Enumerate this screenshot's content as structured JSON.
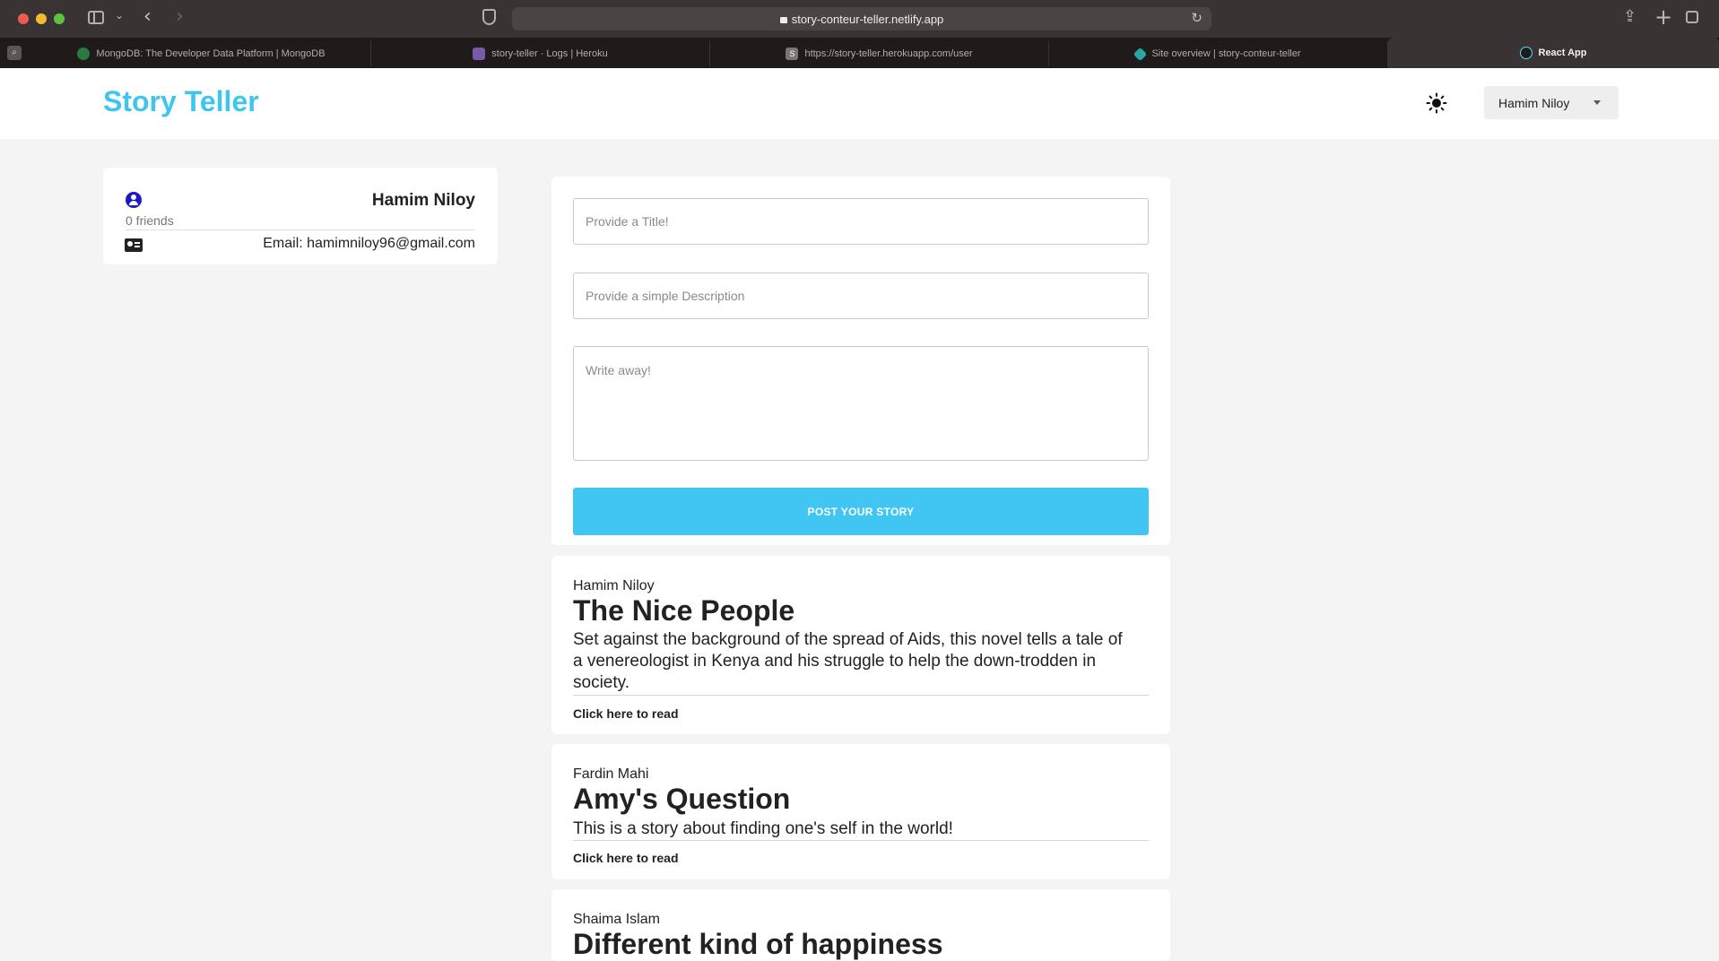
{
  "browser": {
    "url": "story-conteur-teller.netlify.app",
    "tabs": [
      {
        "label": "MongoDB: The Developer Data Platform | MongoDB"
      },
      {
        "label": "story-teller · Logs | Heroku"
      },
      {
        "label": "https://story-teller.herokuapp.com/user"
      },
      {
        "label": "Site overview | story-conteur-teller"
      },
      {
        "label": "React App"
      }
    ]
  },
  "header": {
    "brand": "Story Teller",
    "user_menu": "Hamim Niloy"
  },
  "profile": {
    "name": "Hamim Niloy",
    "friends": "0 friends",
    "email": "Email: hamimniloy96@gmail.com"
  },
  "form": {
    "title_placeholder": "Provide a Title!",
    "description_placeholder": "Provide a simple Description",
    "body_placeholder": "Write away!",
    "submit_label": "POST YOUR STORY"
  },
  "stories": [
    {
      "author": "Hamim Niloy",
      "title": "The Nice People",
      "description": "Set against the background of the spread of Aids, this novel tells a tale of a venereologist in Kenya and his struggle to help the down-trodden in society.",
      "link": "Click here to read"
    },
    {
      "author": "Fardin Mahi",
      "title": "Amy's Question",
      "description": "This is a story about finding one's self in the world!",
      "link": "Click here to read"
    },
    {
      "author": "Shaima Islam",
      "title": "Different kind of happiness"
    }
  ],
  "colors": {
    "brand": "#3ec5f0",
    "button": "#41c6f3",
    "profile_icon": "#1d19c9"
  }
}
